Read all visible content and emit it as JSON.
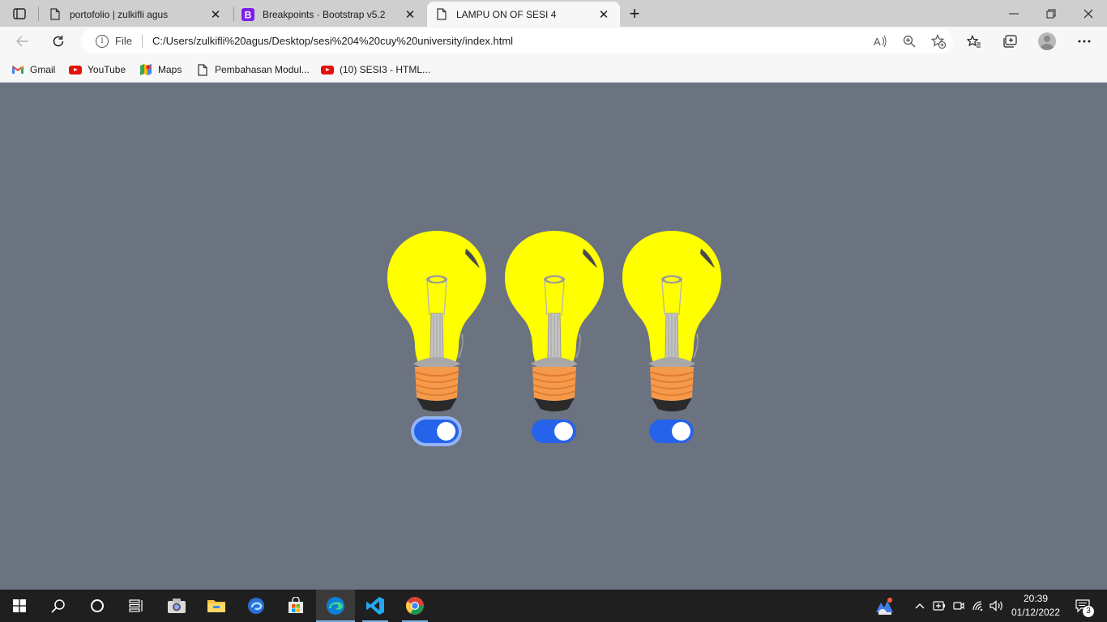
{
  "browser": {
    "tabs": [
      {
        "title": "portofolio | zulkifli agus",
        "icon": "page-icon",
        "active": false
      },
      {
        "title": "Breakpoints · Bootstrap v5.2",
        "icon": "bootstrap-icon",
        "active": false
      },
      {
        "title": "LAMPU ON OF SESI 4",
        "icon": "page-icon",
        "active": true
      }
    ],
    "new_tab_label": "+",
    "close_glyph": "✕",
    "address": {
      "scheme_label": "File",
      "url": "C:/Users/zulkifli%20agus/Desktop/sesi%204%20cuy%20university/index.html"
    },
    "bookmarks": [
      {
        "label": "Gmail",
        "icon": "gmail-icon"
      },
      {
        "label": "YouTube",
        "icon": "youtube-icon"
      },
      {
        "label": "Maps",
        "icon": "maps-icon"
      },
      {
        "label": "Pembahasan Modul...",
        "icon": "page-icon"
      },
      {
        "label": "(10) SESI3 - HTML...",
        "icon": "youtube-icon"
      }
    ]
  },
  "page": {
    "background": "#6b7280",
    "lamps": [
      {
        "state": "on",
        "switch_checked": true,
        "focused": true
      },
      {
        "state": "on",
        "switch_checked": true,
        "focused": false
      },
      {
        "state": "on",
        "switch_checked": true,
        "focused": false
      }
    ],
    "colors": {
      "bulb": "#ffff00",
      "switch": "#2563eb",
      "focus_ring": "#93b4f5",
      "base": "#f59a4c"
    }
  },
  "taskbar": {
    "apps": [
      "start-icon",
      "search-icon",
      "cortana-icon",
      "task-view-icon",
      "camera-icon",
      "file-explorer-icon",
      "edge-dev-icon",
      "store-icon",
      "edge-icon",
      "vscode-icon",
      "chrome-icon"
    ],
    "clock_time": "20:39",
    "clock_date": "01/12/2022",
    "notification_count": "3"
  }
}
